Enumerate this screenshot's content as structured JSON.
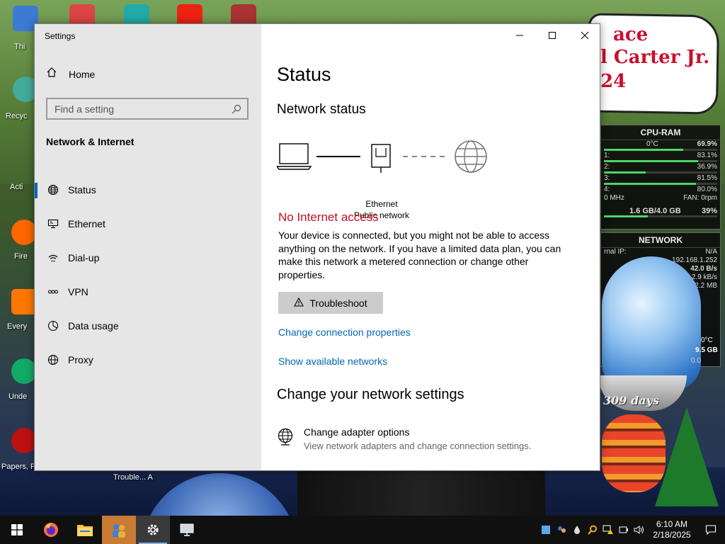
{
  "window": {
    "title": "Settings"
  },
  "sidebar": {
    "home_label": "Home",
    "search_placeholder": "Find a setting",
    "section_title": "Network & Internet",
    "items": [
      {
        "label": "Status",
        "icon": "globe-status-icon",
        "active": true
      },
      {
        "label": "Ethernet",
        "icon": "ethernet-icon",
        "active": false
      },
      {
        "label": "Dial-up",
        "icon": "dial-up-icon",
        "active": false
      },
      {
        "label": "VPN",
        "icon": "vpn-icon",
        "active": false
      },
      {
        "label": "Data usage",
        "icon": "data-usage-icon",
        "active": false
      },
      {
        "label": "Proxy",
        "icon": "globe-icon",
        "active": false
      }
    ]
  },
  "main": {
    "page_title": "Status",
    "network_status_heading": "Network status",
    "connection_name": "Ethernet",
    "connection_type": "Public network",
    "status_text": "No Internet access",
    "status_description": "Your device is connected, but you might not be able to access anything on the network. If you have a limited data plan, you can make this network a metered connection or change other properties.",
    "troubleshoot_label": "Troubleshoot",
    "link_change_connection": "Change connection properties",
    "link_show_networks": "Show available networks",
    "change_settings_heading": "Change your network settings",
    "adapter_title": "Change adapter options",
    "adapter_subtitle": "View network adapters and change connection settings."
  },
  "desktop": {
    "icon_labels": [
      "Thi",
      "Recyc",
      "Acti",
      "Fire",
      "Every",
      "Unde",
      "Papers, P"
    ],
    "trouble_label": "Trouble... A",
    "banner_lines": [
      "ace",
      "l Carter Jr.",
      "24"
    ],
    "days_label": "309 days"
  },
  "widgets": {
    "cpu": {
      "title": "CPU-RAM",
      "temp": "0°C",
      "total": "69.9%",
      "cores": [
        {
          "name": "1:",
          "value": "83.1%",
          "fill": 0.83
        },
        {
          "name": "2:",
          "value": "36.9%",
          "fill": 0.37
        },
        {
          "name": "3:",
          "value": "81.5%",
          "fill": 0.815
        },
        {
          "name": "4:",
          "value": "80.0%",
          "fill": 0.8
        }
      ],
      "freq": "0 MHz",
      "fan": "FAN: 0rpm",
      "ram": "1.6 GB/4.0 GB",
      "ram_pct": "39%"
    },
    "network": {
      "title": "NETWORK",
      "internal_ip_label": "rnal IP:",
      "internal_ip_value": "N/A",
      "ip": "192.168.1.252",
      "down": "42.0 B/s",
      "up_rate": "2.9 kB/s",
      "total": "22.2 MB",
      "temp": "0°C",
      "extra": "9.5 GB",
      "extra2": "0.0"
    }
  },
  "taskbar": {
    "time": "6:10 AM",
    "date": "2/18/2025"
  }
}
